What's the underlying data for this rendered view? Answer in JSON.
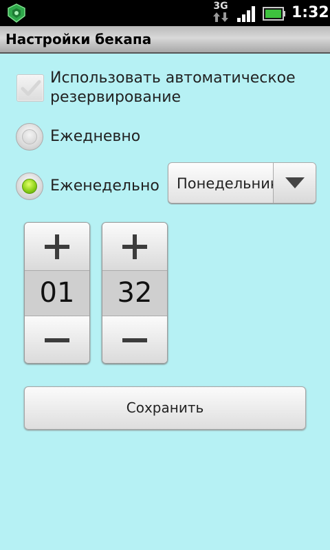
{
  "status_bar": {
    "network_type": "3G",
    "time": "1:32",
    "icons": [
      "app-notification-icon",
      "network-3g-icon",
      "signal-icon",
      "battery-icon"
    ]
  },
  "title_bar": {
    "title": "Настройки бекапа"
  },
  "settings": {
    "auto_backup": {
      "label": "Использовать автоматическое резервирование",
      "checked": true
    },
    "daily": {
      "label": "Ежедневно",
      "selected": false
    },
    "weekly": {
      "label": "Еженедельно",
      "selected": true
    },
    "day_select": {
      "value": "Понедельник"
    },
    "hour_picker": {
      "value": "01"
    },
    "minute_picker": {
      "value": "32"
    },
    "save_label": "Сохранить"
  },
  "colors": {
    "background": "#b6f1f4",
    "radio_on": "#8fd21a"
  }
}
